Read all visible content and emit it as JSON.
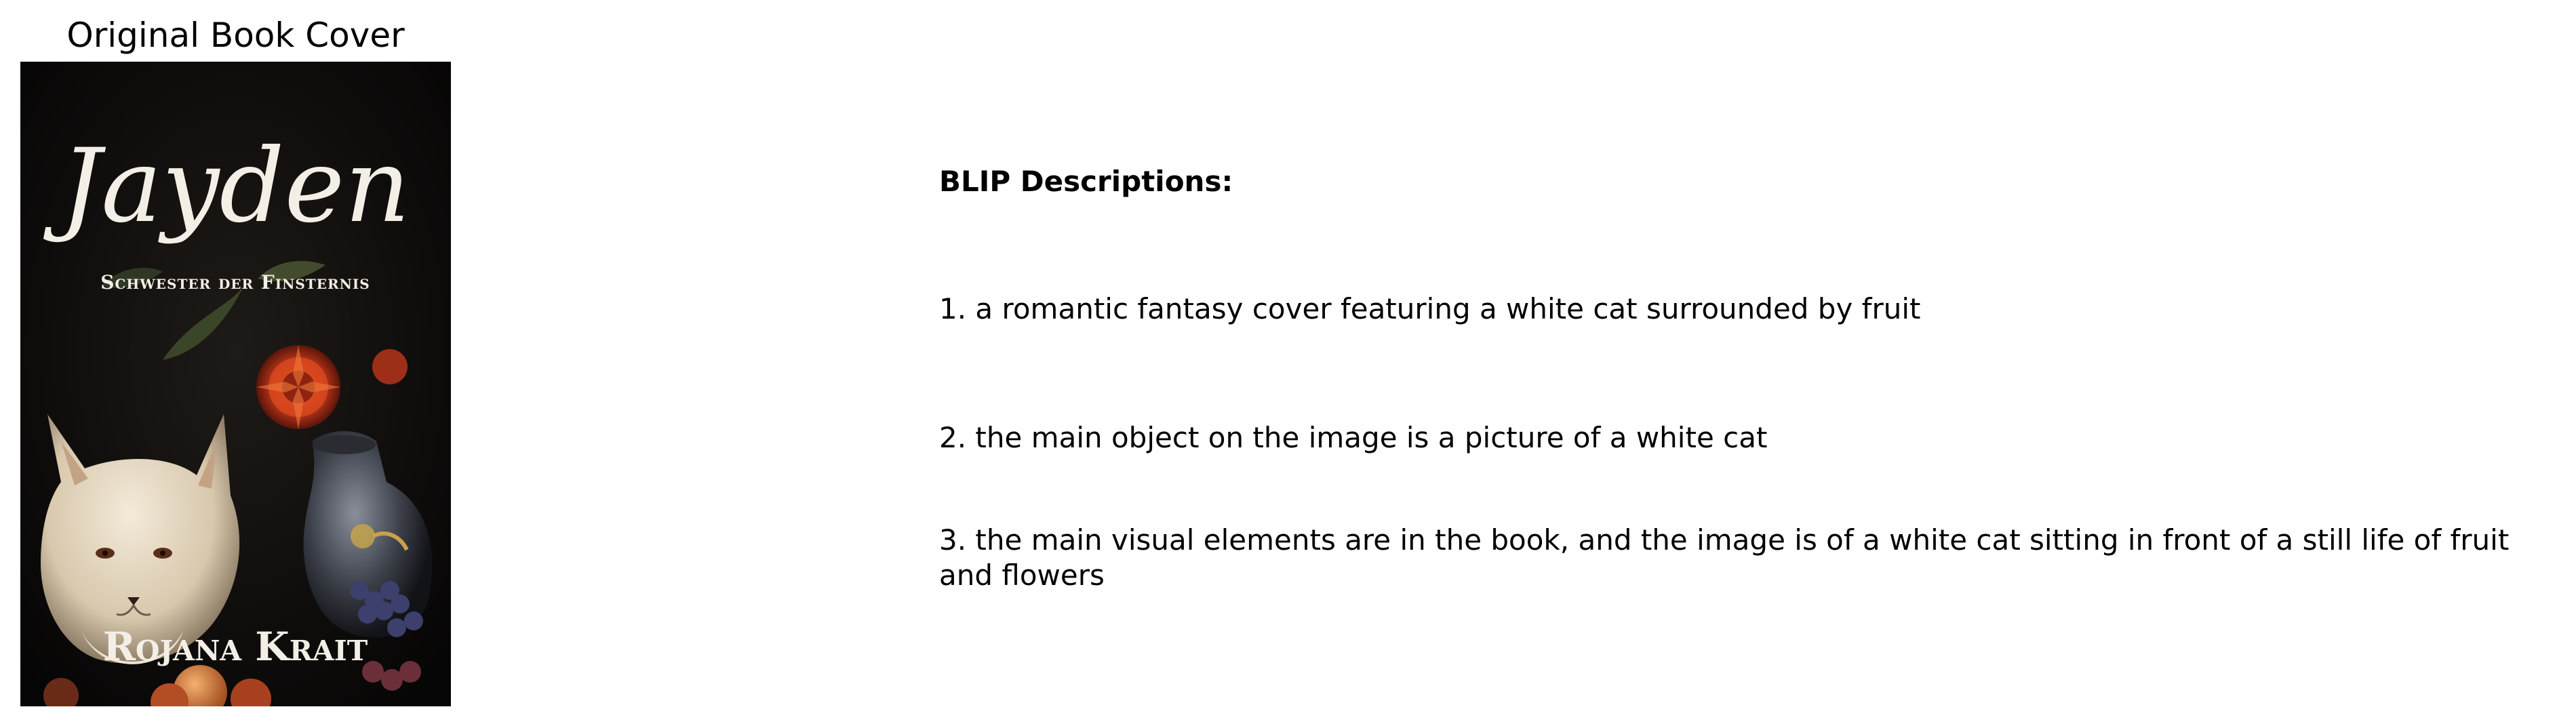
{
  "figure": {
    "title": "Original Book Cover"
  },
  "cover": {
    "title": "Jayden",
    "subtitle": "Schwester der Finsternis",
    "author": "Rojana Krait"
  },
  "descriptions": {
    "heading": "BLIP Descriptions:",
    "items": [
      "1. a romantic fantasy cover featuring a white cat surrounded by fruit",
      "2. the main object on the image is a picture of a white cat",
      "3. the main visual elements are in the book, and the image is of a white cat sitting in front of a still life of fruit and flowers"
    ]
  }
}
